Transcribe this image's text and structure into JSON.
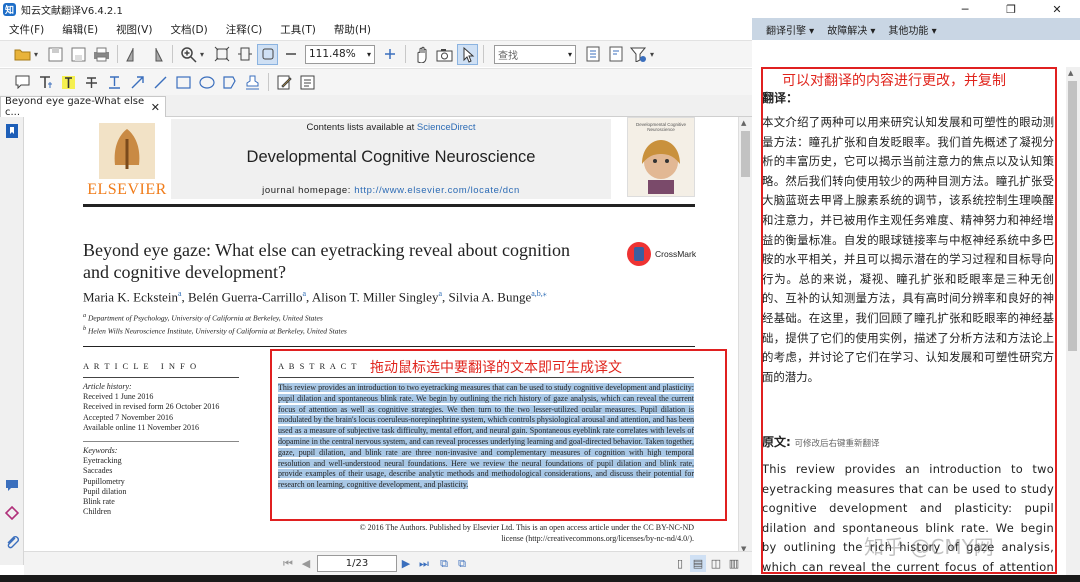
{
  "app": {
    "logo_char": "知",
    "title": "知云文献翻译V6.4.2.1"
  },
  "menu": [
    "文件(F)",
    "编辑(E)",
    "视图(V)",
    "文档(D)",
    "注释(C)",
    "工具(T)",
    "帮助(H)"
  ],
  "toolbar": {
    "zoom": "111.48%",
    "search_placeholder": "查找"
  },
  "tab": {
    "label": "Beyond eye gaze-What else c...",
    "close": "✕"
  },
  "paper": {
    "contents_prefix": "Contents lists available at ",
    "contents_link": "ScienceDirect",
    "journal": "Developmental Cognitive Neuroscience",
    "homepage_prefix": "journal homepage: ",
    "homepage_url": "http://www.elsevier.com/locate/dcn",
    "publisher": "ELSEVIER",
    "cover_title": "Developmental Cognitive Neuroscience",
    "title_line1": "Beyond eye gaze: What else can eyetracking reveal about cognition",
    "title_line2": "and cognitive development?",
    "crossmark": "CrossMark",
    "authors": [
      {
        "name": "Maria K. Eckstein",
        "sup": "a"
      },
      {
        "name": "Belén Guerra-Carrillo",
        "sup": "a"
      },
      {
        "name": "Alison T. Miller Singley",
        "sup": "a"
      },
      {
        "name": "Silvia A. Bunge",
        "sup": "a,b,⁎"
      }
    ],
    "affil_a_sup": "a",
    "affil_a": "Department of Psychology, University of California at Berkeley, United States",
    "affil_b_sup": "b",
    "affil_b": "Helen Wills Neuroscience Institute, University of California at Berkeley, United States",
    "article_info_heading": "A R T I C L E   I N F O",
    "history_label": "Article history:",
    "history": [
      "Received 1 June 2016",
      "Received in revised form 26 October 2016",
      "Accepted 7 November 2016",
      "Available online 11 November 2016"
    ],
    "keywords_label": "Keywords:",
    "keywords": [
      "Eyetracking",
      "Saccades",
      "Pupillometry",
      "Pupil dilation",
      "Blink rate",
      "Children"
    ],
    "abstract_heading": "A B S T R A C T",
    "abstract": "This review provides an introduction to two eyetracking measures that can be used to study cognitive development and plasticity: pupil dilation and spontaneous blink rate. We begin by outlining the rich history of gaze analysis, which can reveal the current focus of attention as well as cognitive strategies. We then turn to the two lesser-utilized ocular measures. Pupil dilation is modulated by the brain's locus coeruleus-norepinephrine system, which controls physiological arousal and attention, and has been used as a measure of subjective task difficulty, mental effort, and neural gain. Spontaneous eyeblink rate correlates with levels of dopamine in the central nervous system, and can reveal processes underlying learning and goal-directed behavior. Taken together, gaze, pupil dilation, and blink rate are three non-invasive and complementary measures of cognition with high temporal resolution and well-understood neural foundations. Here we review the neural foundations of pupil dilation and blink rate, provide examples of their usage, describe analytic methods and methodological considerations, and discuss their potential for research on learning, cognitive development, and plasticity.",
    "license_line1": "© 2016 The Authors. Published by Elsevier Ltd. This is an open access article under the CC BY-NC-ND",
    "license_line2": "license (http://creativecommons.org/licenses/by-nc-nd/4.0/).",
    "annotation": "拖动鼠标选中要翻译的文本即可生成译文"
  },
  "pager": {
    "current": "1/23"
  },
  "right_panel": {
    "menus": [
      "翻译引擎 ▾",
      "故障解决 ▾",
      "其他功能 ▾"
    ],
    "annotation": "可以对翻译的内容进行更改，并复制",
    "translation_label": "翻译：",
    "translation": "本文介绍了两种可以用来研究认知发展和可塑性的眼动测量方法：瞳孔扩张和自发眨眼率。我们首先概述了凝视分析的丰富历史，它可以揭示当前注意力的焦点以及认知策略。然后我们转向使用较少的两种目测方法。瞳孔扩张受大脑蓝斑去甲肾上腺素系统的调节，该系统控制生理唤醒和注意力，并已被用作主观任务难度、精神努力和神经增益的衡量标准。自发的眼球链接率与中枢神经系统中多巴胺的水平相关，并且可以揭示潜在的学习过程和目标导向行为。总的来说，凝视、瞳孔扩张和眨眼率是三种无创的、互补的认知测量方法，具有高时间分辨率和良好的神经基础。在这里，我们回顾了瞳孔扩张和眨眼率的神经基础，提供了它们的使用实例，描述了分析方法和方法论上的考虑，并讨论了它们在学习、认知发展和可塑性研究方面的潜力。",
    "original_label": "原文:",
    "original_hint": "可修改后右键重新翻译",
    "original": "This review provides an introduction to two eyetracking measures that can be used to study cognitive development and plasticity: pupil dilation and spontaneous blink rate. We begin by outlining the rich history of gaze analysis, which can reveal the current focus of attention as well",
    "watermark": "知乎 @CMY网"
  },
  "colors": {
    "accent": "#1e6ec8",
    "annotation_red": "#e0251d",
    "selection": "#a9c8e6",
    "panel_header": "#c9d6e4",
    "elsevier_orange": "#f07c1a"
  }
}
